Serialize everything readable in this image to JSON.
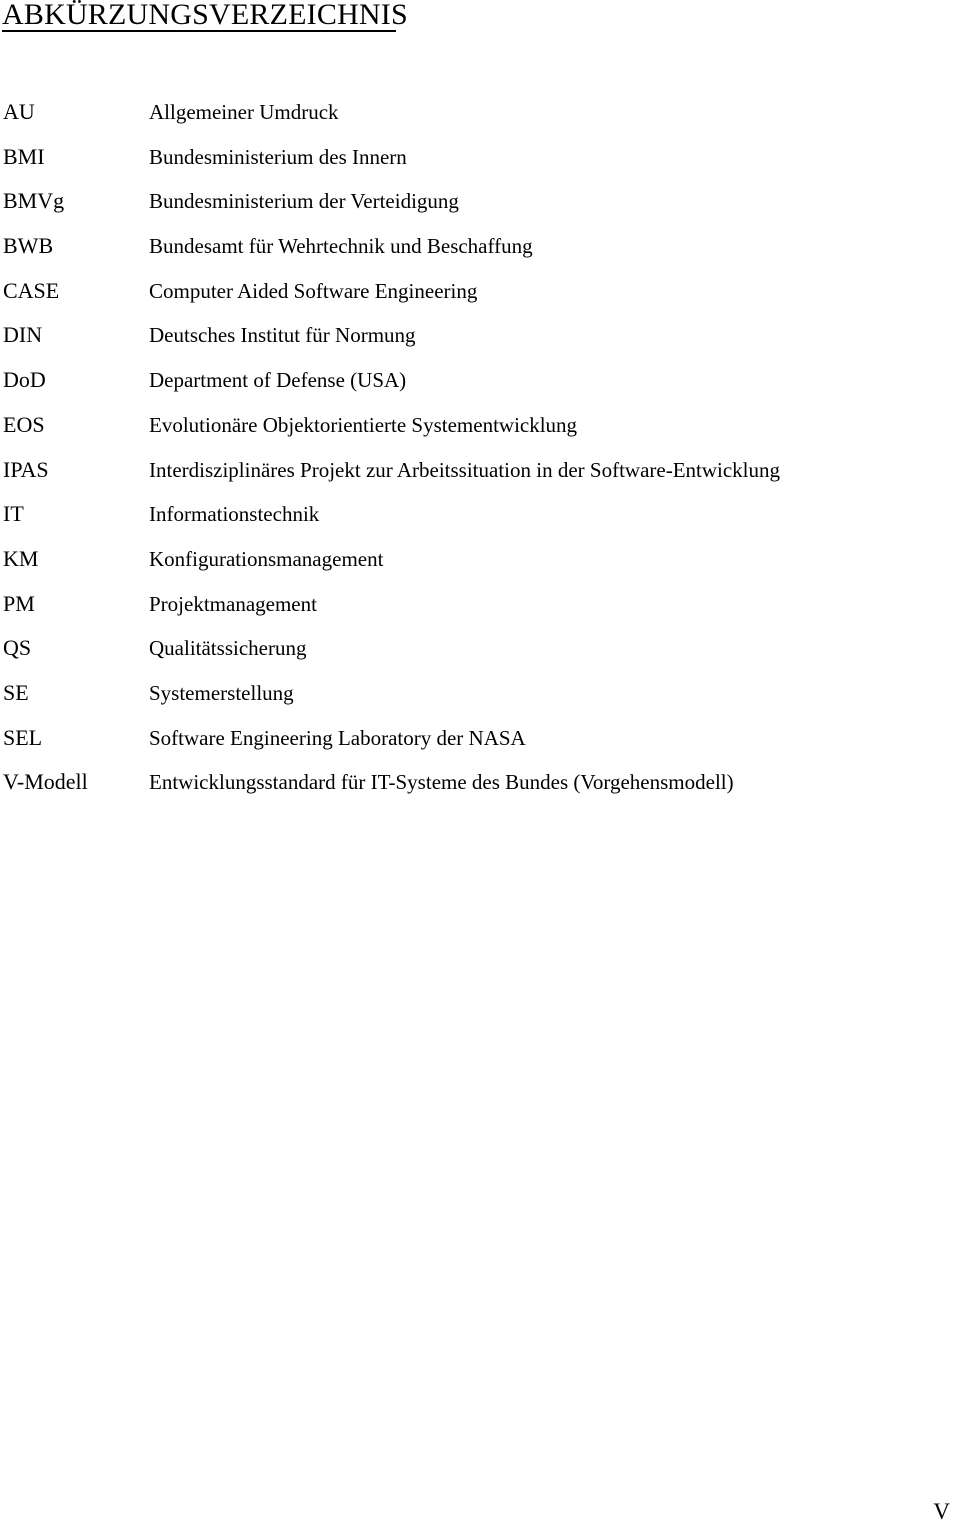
{
  "document": {
    "title": "ABKÜRZUNGSVERZEICHNIS",
    "page_number": "V"
  },
  "abbreviations": [
    {
      "term": "AU",
      "definition": "Allgemeiner Umdruck"
    },
    {
      "term": "BMI",
      "definition": "Bundesministerium des Innern"
    },
    {
      "term": "BMVg",
      "definition": "Bundesministerium der Verteidigung"
    },
    {
      "term": "BWB",
      "definition": "Bundesamt für Wehrtechnik und Beschaffung"
    },
    {
      "term": "CASE",
      "definition": "Computer Aided Software Engineering"
    },
    {
      "term": "DIN",
      "definition": "Deutsches Institut für Normung"
    },
    {
      "term": "DoD",
      "definition": "Department of Defense (USA)"
    },
    {
      "term": "EOS",
      "definition": "Evolutionäre Objektorientierte Systementwicklung"
    },
    {
      "term": "IPAS",
      "definition": "Interdisziplinäres Projekt zur Arbeitssituation in der Software-Entwicklung"
    },
    {
      "term": "IT",
      "definition": "Informationstechnik"
    },
    {
      "term": "KM",
      "definition": "Konfigurationsmanagement"
    },
    {
      "term": "PM",
      "definition": "Projektmanagement"
    },
    {
      "term": "QS",
      "definition": "Qualitätssicherung"
    },
    {
      "term": "SE",
      "definition": "Systemerstellung"
    },
    {
      "term": "SEL",
      "definition": "Software Engineering Laboratory der NASA"
    },
    {
      "term": "V-Modell",
      "definition": "Entwicklungsstandard für IT-Systeme des Bundes (Vorgehensmodell)"
    }
  ]
}
